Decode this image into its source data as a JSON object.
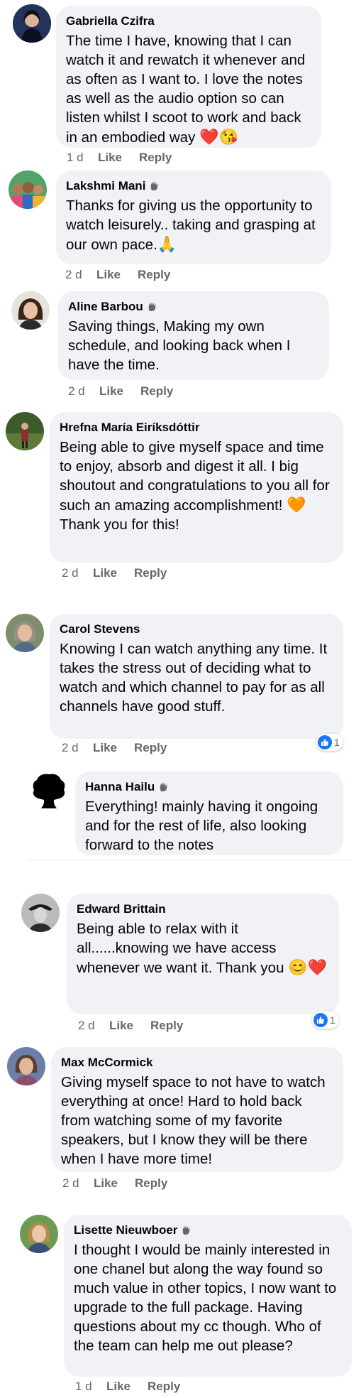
{
  "colors": {
    "bubble": "#f0f2f5",
    "meta": "#65676b",
    "like_blue": "#1877f2",
    "heart": "#e0245e"
  },
  "comments": [
    {
      "author": "Gabriella Czifra",
      "badge": false,
      "text": "The time I have, knowing that I can watch it and rewatch it whenever and as often as I want to. I love the notes as well as the audio option so can listen whilst I scoot to work and back in an embodied way",
      "emoji": "❤️😘",
      "time": "1 d",
      "like": "Like",
      "reply": "Reply"
    },
    {
      "author": "Lakshmi Mani",
      "badge": true,
      "text": "Thanks for giving us the opportunity to watch leisurely.. taking and grasping at our own pace.",
      "emoji": "🙏",
      "time": "2 d",
      "like": "Like",
      "reply": "Reply"
    },
    {
      "author": "Aline Barbou",
      "badge": true,
      "text": "Saving things, Making my own schedule, and looking back when I have the time.",
      "emoji": "",
      "time": "2 d",
      "like": "Like",
      "reply": "Reply"
    },
    {
      "author": "Hrefna María Eiríksdóttir",
      "badge": false,
      "text": "Being able to give myself space and time to enjoy, absorb and digest it all. I big shoutout and congratulations to you all for such an amazing accomplishment!",
      "emoji": "🧡",
      "text2": "Thank you for this!",
      "time": "2 d",
      "like": "Like",
      "reply": "Reply"
    },
    {
      "author": "Carol Stevens",
      "badge": false,
      "text": "Knowing I can watch anything any time. It takes the stress out of deciding what to watch and which channel to pay for as all channels have good stuff.",
      "emoji": "",
      "time": "2 d",
      "like": "Like",
      "reply": "Reply",
      "reactions": "1"
    },
    {
      "author": "Hanna Hailu",
      "badge": true,
      "text": "Everything! mainly having it ongoing and for the rest of life, also looking forward to the notes",
      "emoji": ""
    },
    {
      "author": "Edward Brittain",
      "badge": false,
      "text": "Being able to relax with it all......knowing we have access whenever we want it. Thank you",
      "emoji": "😊❤️",
      "time": "2 d",
      "like": "Like",
      "reply": "Reply",
      "reactions": "1"
    },
    {
      "author": "Max McCormick",
      "badge": false,
      "text": "Giving myself space to not have to watch everything at once! Hard to hold back from watching some of my favorite speakers, but I know they will be there when I have more time!",
      "emoji": "",
      "time": "2 d",
      "like": "Like",
      "reply": "Reply"
    },
    {
      "author": "Lisette Nieuwboer",
      "badge": true,
      "text": "I thought I would be mainly interested in one chanel but along the way found so much value in other topics, I now want to upgrade to the full package. Having questions about my cc though. Who of the team can help me out please?",
      "emoji": "",
      "time": "1 d",
      "like": "Like",
      "reply": "Reply"
    }
  ]
}
